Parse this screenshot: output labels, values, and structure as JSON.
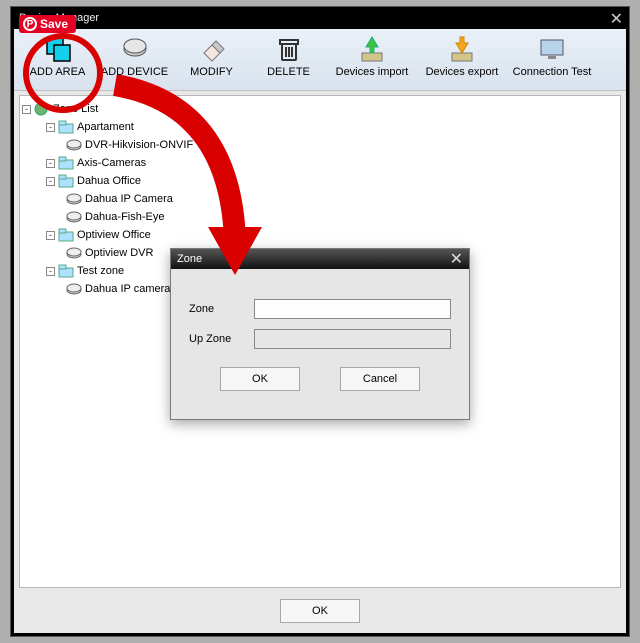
{
  "window": {
    "title": "Device Manager"
  },
  "toolbar": {
    "items": [
      {
        "label": "ADD AREA"
      },
      {
        "label": "ADD DEVICE"
      },
      {
        "label": "MODIFY"
      },
      {
        "label": "DELETE"
      },
      {
        "label": "Devices import"
      },
      {
        "label": "Devices export"
      },
      {
        "label": "Connection Test"
      }
    ]
  },
  "tree": {
    "root": "Zone List",
    "nodes": [
      {
        "label": "Apartament",
        "depth": 1,
        "type": "area"
      },
      {
        "label": "DVR-Hikvision-ONVIF",
        "depth": 2,
        "type": "device"
      },
      {
        "label": "Axis-Cameras",
        "depth": 1,
        "type": "area"
      },
      {
        "label": "Dahua Office",
        "depth": 1,
        "type": "area"
      },
      {
        "label": "Dahua IP Camera",
        "depth": 2,
        "type": "device"
      },
      {
        "label": "Dahua-Fish-Eye",
        "depth": 2,
        "type": "device"
      },
      {
        "label": "Optiview Office",
        "depth": 1,
        "type": "area"
      },
      {
        "label": "Optiview DVR",
        "depth": 2,
        "type": "device"
      },
      {
        "label": "Test zone",
        "depth": 1,
        "type": "area"
      },
      {
        "label": "Dahua IP camera",
        "depth": 2,
        "type": "device"
      }
    ]
  },
  "dialog": {
    "title": "Zone",
    "field1_label": "Zone",
    "field1_value": "",
    "field2_label": "Up Zone",
    "field2_value": "",
    "ok": "OK",
    "cancel": "Cancel"
  },
  "footer": {
    "ok": "OK"
  },
  "overlay": {
    "save": "Save"
  },
  "highlight_target": "toolbar.items.0"
}
